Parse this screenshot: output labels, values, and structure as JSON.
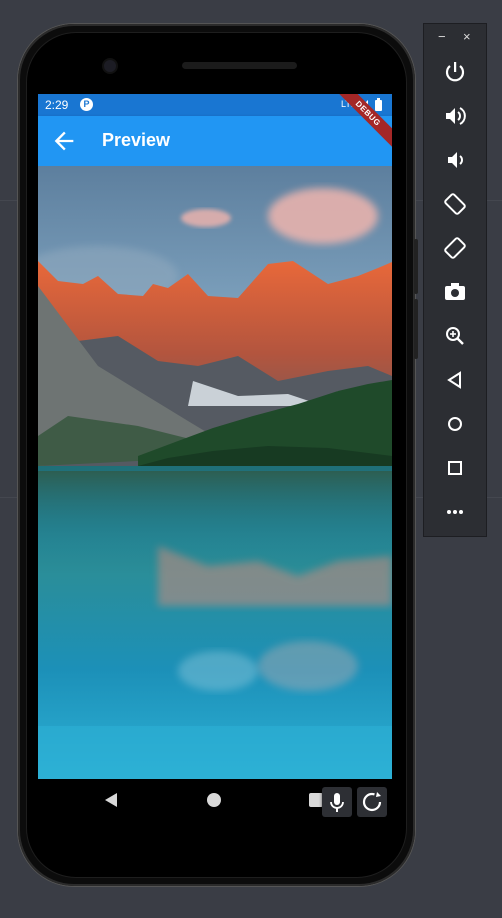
{
  "status_bar": {
    "time": "2:29",
    "app_icon": "P",
    "network": "LTE",
    "icons": [
      "signal-icon",
      "battery-icon"
    ]
  },
  "app_bar": {
    "title": "Preview",
    "back_icon": "arrow-back-icon"
  },
  "debug_banner": "DEBUG",
  "preview_image": {
    "subject": "mountain lake landscape"
  },
  "nav_bar": {
    "buttons": [
      "back-triangle-icon",
      "home-circle-icon",
      "recent-square-icon"
    ]
  },
  "floating_buttons": [
    "microphone-icon",
    "rotate-icon"
  ],
  "emulator_toolbar": {
    "window_controls": {
      "minimize": "−",
      "close": "×"
    },
    "buttons": [
      "power-icon",
      "volume-up-icon",
      "volume-down-icon",
      "rotate-left-icon",
      "rotate-right-icon",
      "camera-icon",
      "zoom-icon",
      "back-icon",
      "home-icon",
      "overview-icon",
      "more-icon"
    ]
  },
  "colors": {
    "status_bar": "#1976D2",
    "app_bar": "#2196F3",
    "debug_banner": "#a42727",
    "desktop": "#3a3d45"
  }
}
